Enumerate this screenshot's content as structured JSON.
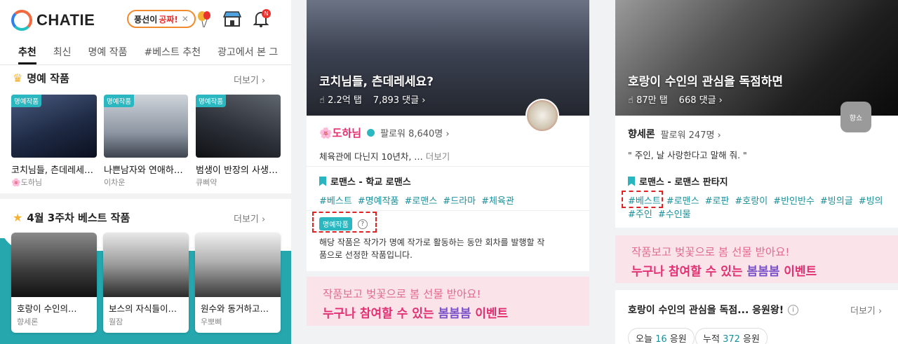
{
  "panel1": {
    "logo_text": "CHATIE",
    "balloon_pill": {
      "text": "풍선이",
      "highlight": "공짜!",
      "close": "✕"
    },
    "notification_badge": "N",
    "tabs": [
      "추천",
      "최신",
      "명예 작품",
      "#베스트 추천",
      "광고에서 본 그"
    ],
    "section_honor": {
      "title": "명예 작품",
      "more": "더보기 ›"
    },
    "honor_cards": [
      {
        "badge": "명예작품",
        "title": "코치님들, 츤데레세…",
        "author": "🌸도하님"
      },
      {
        "badge": "명예작품",
        "title": "나쁜남자와 연애하…",
        "author": "이차운"
      },
      {
        "badge": "명예작품",
        "title": "범생이 반장의 사생…",
        "author": "큐삐약"
      }
    ],
    "section_best": {
      "title": "4월 3주차 베스트 작품",
      "more": "더보기 ›"
    },
    "best_cards": [
      {
        "title": "호랑이 수인의…",
        "author": "향세론"
      },
      {
        "title": "보스의 자식들이…",
        "author": "월잠"
      },
      {
        "title": "원수와 동거하고…",
        "author": "우뽀삐"
      }
    ]
  },
  "panel2": {
    "hero_title": "코치님들, 츤데레세요?",
    "stats": {
      "taps": "2.2억 탭",
      "comments": "7,893 댓글 ›"
    },
    "author": "🌸도하님",
    "followers": "팔로워 8,640명 ›",
    "desc": "체육관에 다닌지 10년차, …",
    "desc_more": "더보기",
    "genre": "로맨스 - 학교 로맨스",
    "tags": [
      "#베스트",
      "#명예작품",
      "#로맨스",
      "#드라마",
      "#체육관"
    ],
    "honor_badge": "명예작품",
    "help": "?",
    "honor_desc_1": "해당 작품은 작가가 명예 작가로 활동하는 동안 회차를 발행할 작",
    "honor_desc_2": "품으로 선정한 작품입니다.",
    "banner": {
      "line1": "작품보고 벚꽃으로 봄 선물 받아요!",
      "line2a": "누구나 참여할 수 있는 ",
      "line2b": "봄봄봄",
      "line2c": " 이벤트"
    }
  },
  "panel3": {
    "hero_title": "호랑이 수인의 관심을 독점하면",
    "stats": {
      "taps": "87만 탭",
      "comments": "668 댓글 ›"
    },
    "avatar_text": "향쇼",
    "author": "향세론",
    "followers": "팔로워 247명 ›",
    "desc": "\" 주인, 날 사랑한다고 말해 줘. \"",
    "genre": "로맨스 - 로맨스 판타지",
    "tags_row1": [
      "#베스트",
      "#로맨스",
      "#로판",
      "#호랑이",
      "#반인반수",
      "#빙의글",
      "#빙의"
    ],
    "tags_row2": [
      "#주인",
      "#수인물"
    ],
    "banner": {
      "line1": "작품보고 벚꽃으로 봄 선물 받아요!",
      "line2a": "누구나 참여할 수 있는 ",
      "line2b": "봄봄봄",
      "line2c": " 이벤트"
    },
    "support_title": "호랑이 수인의 관심을 독점... 응원왕!",
    "support_more": "더보기 ›",
    "today": {
      "label": "오늘 ",
      "num": "16",
      "unit": " 응원"
    },
    "total": {
      "label": "누적 ",
      "num": "372",
      "unit": " 응원"
    }
  }
}
